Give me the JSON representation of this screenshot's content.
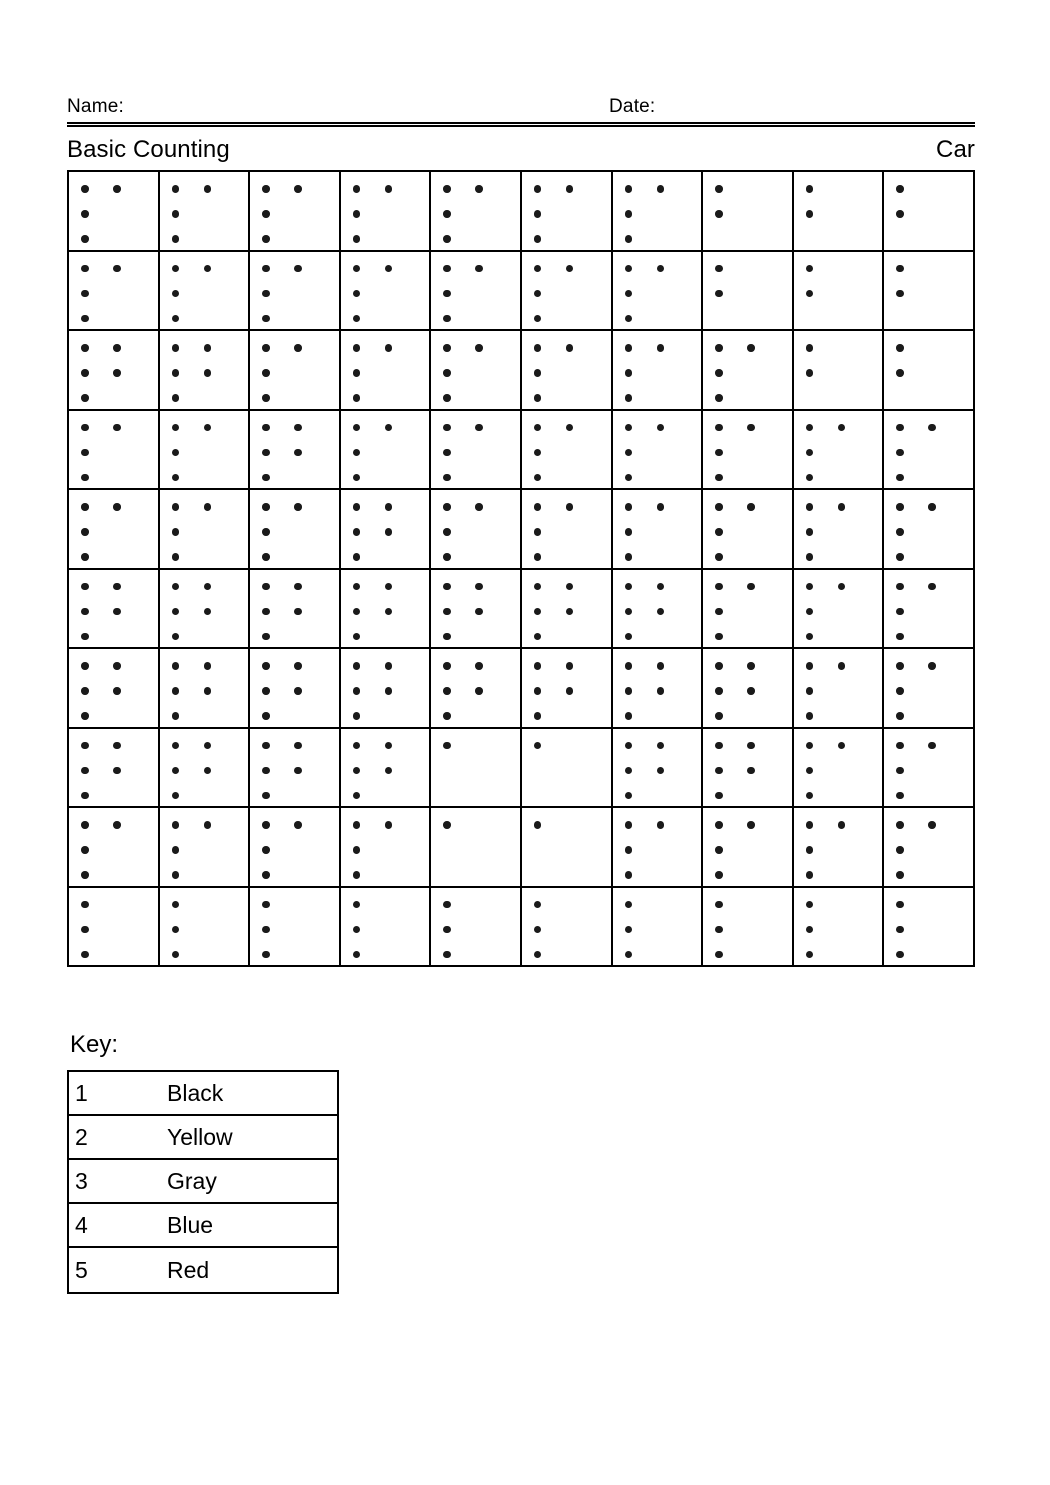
{
  "header": {
    "name_label": "Name:",
    "date_label": "Date:"
  },
  "title": {
    "worksheet_title": "Basic Counting",
    "worksheet_subject": "Car"
  },
  "key": {
    "heading": "Key:",
    "rows": [
      {
        "number": "1",
        "color": "Black"
      },
      {
        "number": "2",
        "color": "Yellow"
      },
      {
        "number": "3",
        "color": "Gray"
      },
      {
        "number": "4",
        "color": "Blue"
      },
      {
        "number": "5",
        "color": "Red"
      }
    ]
  },
  "chart_data": {
    "type": "table",
    "title": "Basic Counting",
    "description": "Color-by-number grid; each cell shows a count of dots from 1 to 5 corresponding to a color in the key.",
    "rows": 10,
    "columns": 10,
    "legend": [
      "1 = Black",
      "2 = Yellow",
      "3 = Gray",
      "4 = Blue",
      "5 = Red"
    ],
    "values": [
      [
        4,
        4,
        4,
        4,
        4,
        4,
        4,
        2,
        2,
        2
      ],
      [
        4,
        4,
        4,
        4,
        4,
        4,
        4,
        2,
        2,
        2
      ],
      [
        5,
        5,
        4,
        4,
        4,
        4,
        4,
        4,
        2,
        2
      ],
      [
        4,
        4,
        5,
        4,
        4,
        4,
        4,
        4,
        4,
        4
      ],
      [
        4,
        4,
        4,
        5,
        4,
        4,
        4,
        4,
        4,
        4
      ],
      [
        5,
        5,
        5,
        5,
        5,
        5,
        5,
        4,
        4,
        4
      ],
      [
        5,
        5,
        5,
        5,
        5,
        5,
        5,
        5,
        4,
        4
      ],
      [
        5,
        5,
        5,
        5,
        1,
        1,
        5,
        5,
        4,
        4
      ],
      [
        4,
        4,
        4,
        4,
        1,
        1,
        4,
        4,
        4,
        4
      ],
      [
        3,
        3,
        3,
        3,
        3,
        3,
        3,
        3,
        3,
        3
      ]
    ]
  }
}
